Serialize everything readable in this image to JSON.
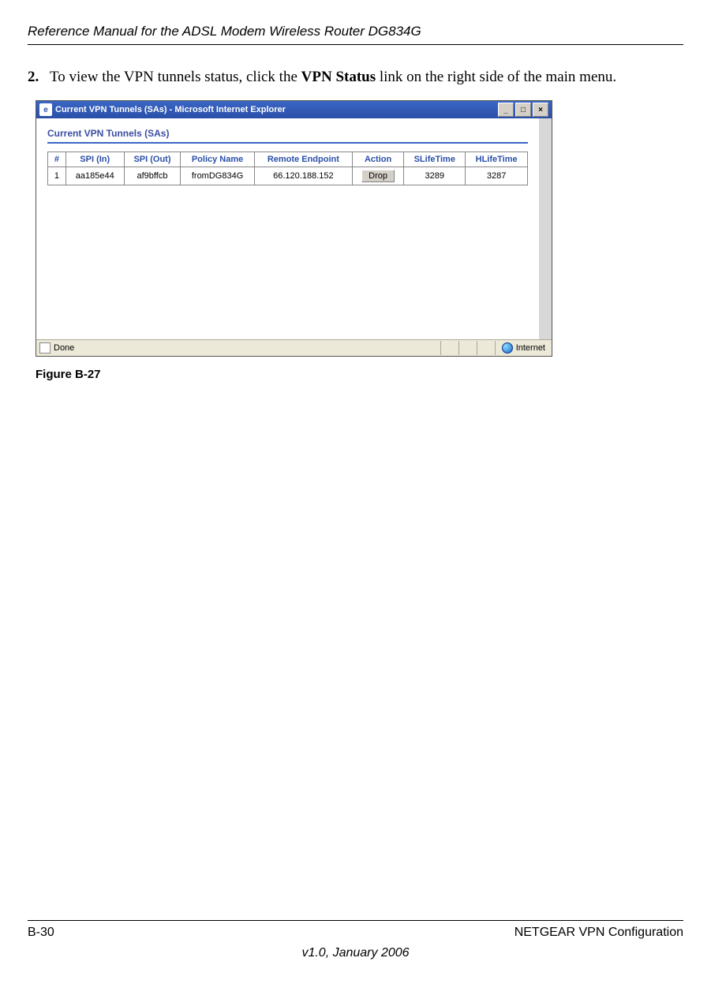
{
  "running_header": "Reference Manual for the ADSL Modem Wireless Router DG834G",
  "step": {
    "number": "2.",
    "text_pre": "To view the VPN tunnels status, click the ",
    "bold": "VPN Status",
    "text_post": " link on the right side of the main menu."
  },
  "browser": {
    "title": "Current VPN Tunnels (SAs) - Microsoft Internet Explorer",
    "panel_title": "Current VPN Tunnels (SAs)",
    "status_left": "Done",
    "status_right": "Internet",
    "sysbtn_min": "_",
    "sysbtn_max": "□",
    "sysbtn_close": "×",
    "ie_icon_label": "e"
  },
  "table": {
    "headers": {
      "num": "#",
      "spi_in": "SPI (In)",
      "spi_out": "SPI (Out)",
      "policy": "Policy Name",
      "remote": "Remote Endpoint",
      "action": "Action",
      "slife": "SLifeTime",
      "hlife": "HLifeTime"
    },
    "row": {
      "num": "1",
      "spi_in": "aa185e44",
      "spi_out": "af9bffcb",
      "policy": "fromDG834G",
      "remote": "66.120.188.152",
      "action_label": "Drop",
      "slife": "3289",
      "hlife": "3287"
    }
  },
  "figure_caption": "Figure B-27",
  "footer": {
    "page": "B-30",
    "right": "NETGEAR VPN Configuration",
    "version": "v1.0, January 2006"
  }
}
